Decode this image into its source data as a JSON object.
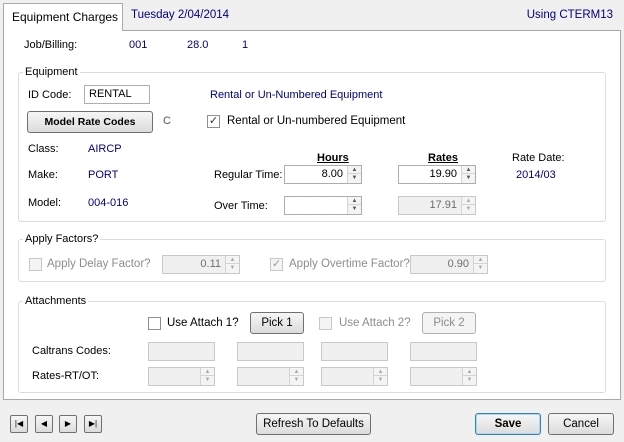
{
  "tab": {
    "label": "Equipment Charges",
    "date": "Tuesday  2/04/2014",
    "using": "Using CTERM13"
  },
  "job": {
    "label": "Job/Billing:",
    "job": "001",
    "billing": "28.0",
    "seq": "1"
  },
  "equipment": {
    "group_title": "Equipment",
    "id_code_label": "ID Code:",
    "id_code_value": "RENTAL",
    "description": "Rental or Un-Numbered Equipment",
    "model_rate_codes_button": "Model Rate Codes",
    "rate_code_letter": "C",
    "rental_checkbox_label": "Rental or Un-numbered Equipment",
    "rental_checked": true,
    "class_label": "Class:",
    "class_value": "AIRCP",
    "make_label": "Make:",
    "make_value": "PORT",
    "model_label": "Model:",
    "model_value": "004-016",
    "hours_header": "Hours",
    "rates_header": "Rates",
    "rate_date_label": "Rate Date:",
    "rate_date_value": "2014/03",
    "regular_time_label": "Regular Time:",
    "regular_hours": "8.00",
    "regular_rate": "19.90",
    "over_time_label": "Over Time:",
    "over_hours": "",
    "over_rate": "17.91"
  },
  "factors": {
    "group_title": "Apply Factors?",
    "delay_label": "Apply Delay Factor?",
    "delay_checked": false,
    "delay_value": "0.11",
    "overtime_label": "Apply Overtime Factor?",
    "overtime_checked": true,
    "overtime_value": "0.90"
  },
  "attachments": {
    "group_title": "Attachments",
    "use_attach1_label": "Use Attach 1?",
    "pick1_label": "Pick 1",
    "use_attach2_label": "Use Attach 2?",
    "pick2_label": "Pick 2",
    "caltrans_label": "Caltrans Codes:",
    "rates_label": "Rates-RT/OT:"
  },
  "footer": {
    "nav_first": "|◀",
    "nav_prev": "◀",
    "nav_next": "▶",
    "nav_last": "▶|",
    "refresh_label": "Refresh To Defaults",
    "save_label": "Save",
    "cancel_label": "Cancel"
  },
  "icons": {
    "check": "✓",
    "spin_up": "▲",
    "spin_down": "▼"
  }
}
